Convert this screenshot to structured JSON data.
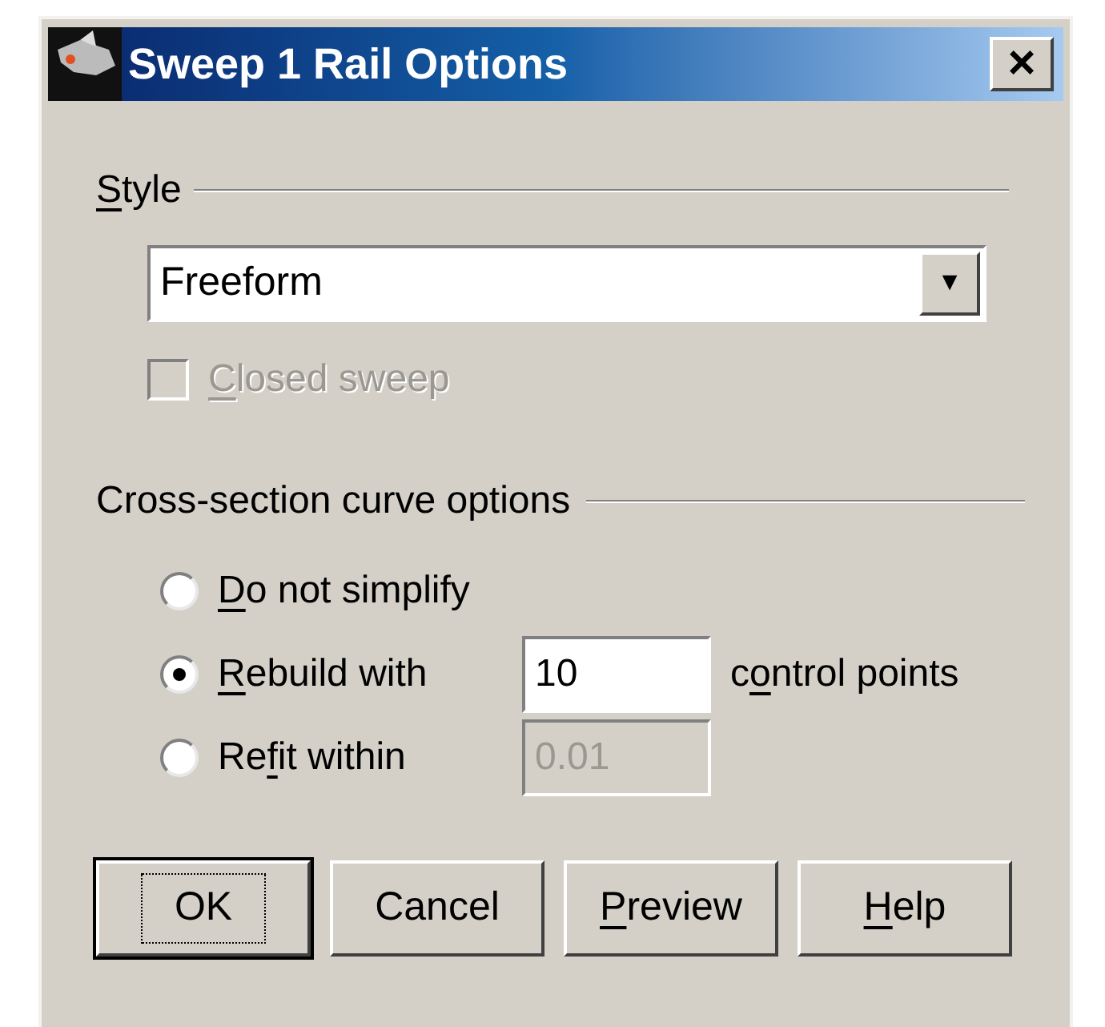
{
  "window": {
    "title": "Sweep 1 Rail Options",
    "close": "×"
  },
  "style_group": {
    "label": [
      {
        "text": "S",
        "underlined": true
      },
      {
        "text": "tyle",
        "underlined": false
      }
    ],
    "dropdown": {
      "value": "Freeform",
      "arrow": "▼"
    },
    "closed_sweep": {
      "label": [
        {
          "text": "C",
          "underlined": true
        },
        {
          "text": "losed sweep",
          "underlined": false
        }
      ],
      "checked": false,
      "disabled": true
    }
  },
  "cross_section_group": {
    "label": [
      {
        "text": "Cross-section curve options",
        "underlined": false
      }
    ],
    "options": [
      {
        "label": [
          {
            "text": "D",
            "underlined": true
          },
          {
            "text": "o not simplify",
            "underlined": false
          }
        ],
        "selected": false
      },
      {
        "label": [
          {
            "text": "R",
            "underlined": true
          },
          {
            "text": "ebuild with",
            "underlined": false
          }
        ],
        "selected": true,
        "field": {
          "value": "10",
          "disabled": false
        },
        "suffix": [
          {
            "text": "c",
            "underlined": false
          },
          {
            "text": "o",
            "underlined": true
          },
          {
            "text": "ntrol points",
            "underlined": false
          }
        ]
      },
      {
        "label": [
          {
            "text": "Re",
            "underlined": false
          },
          {
            "text": "f",
            "underlined": true
          },
          {
            "text": "it within",
            "underlined": false
          }
        ],
        "selected": false,
        "field": {
          "value": "0.01",
          "disabled": true
        }
      }
    ]
  },
  "buttons": [
    {
      "label": [
        {
          "text": "OK",
          "underlined": false
        }
      ],
      "default": true
    },
    {
      "label": [
        {
          "text": "Cancel",
          "underlined": false
        }
      ],
      "default": false
    },
    {
      "label": [
        {
          "text": "P",
          "underlined": true
        },
        {
          "text": "review",
          "underlined": false
        }
      ],
      "default": false
    },
    {
      "label": [
        {
          "text": "H",
          "underlined": true
        },
        {
          "text": "elp",
          "underlined": false
        }
      ],
      "default": false
    }
  ]
}
